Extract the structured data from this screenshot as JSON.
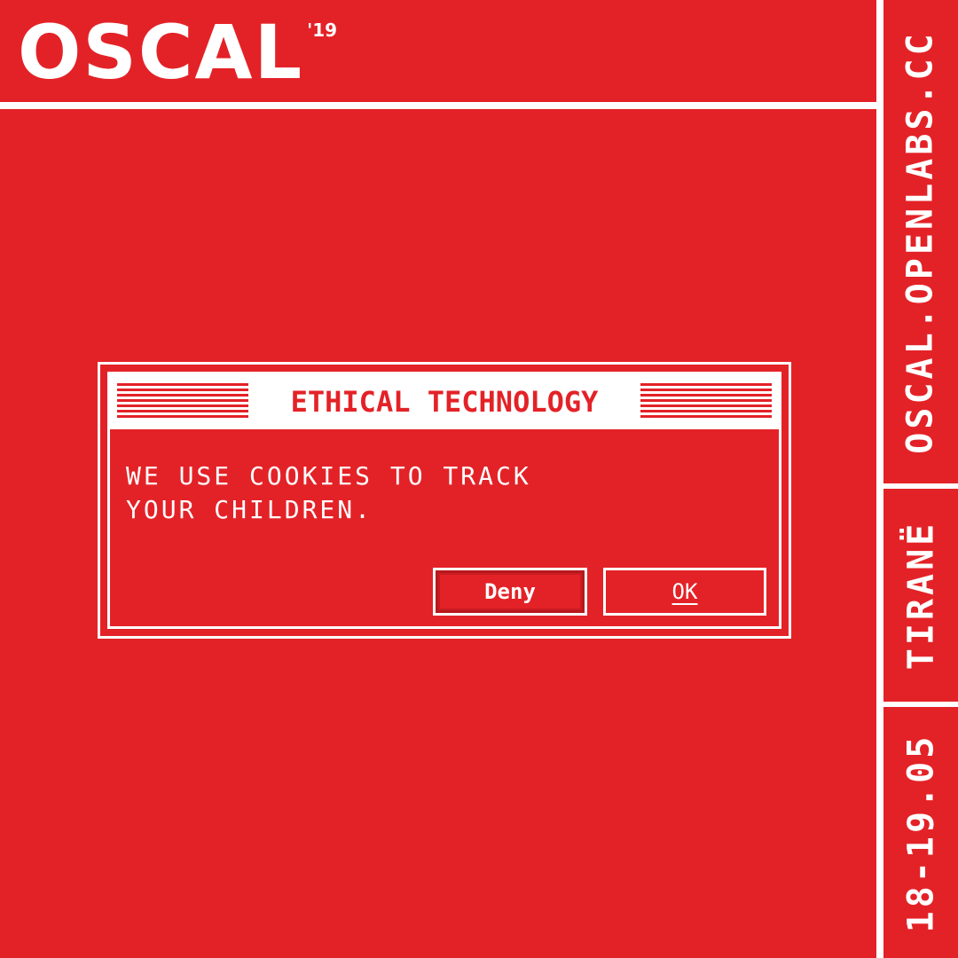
{
  "logo": {
    "name": "OSCAL",
    "year": "'19"
  },
  "sidebar": {
    "website": "OSCAL.OPENLABS.CC",
    "city": "TIRANË",
    "dates": "18-19.05"
  },
  "dialog": {
    "title": "ETHICAL TECHNOLOGY",
    "message": "WE USE COOKIES TO TRACK\nYOUR CHILDREN.",
    "deny_label": "Deny",
    "ok_label": "OK"
  },
  "colors": {
    "background": "#e32227",
    "foreground": "#ffffff"
  }
}
